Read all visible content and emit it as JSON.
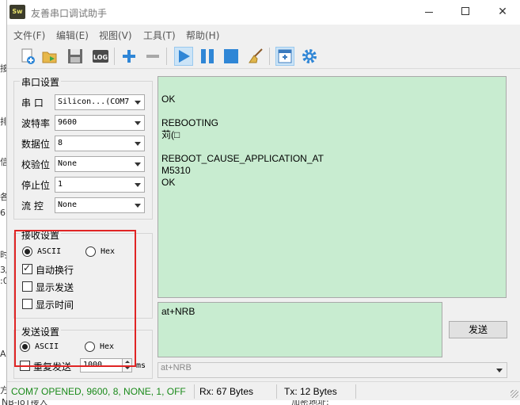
{
  "window": {
    "title": "友善串口调试助手",
    "app_icon_text": "Sw"
  },
  "menu": [
    "文件(F)",
    "编辑(E)",
    "视图(V)",
    "工具(T)",
    "帮助(H)"
  ],
  "toolbar": {
    "icons": [
      "new-icon",
      "open-icon",
      "save-icon",
      "log-icon",
      "add-icon",
      "remove-icon",
      "play-icon",
      "pause-icon",
      "stop-icon",
      "clear-broom-icon",
      "new-window-icon",
      "settings-gear-icon"
    ],
    "log_label": "LOG"
  },
  "serial": {
    "group_title": "串口设置",
    "port_label": "串  口",
    "port_value": "Silicon...(COM7",
    "baud_label": "波特率",
    "baud_value": "9600",
    "databits_label": "数据位",
    "databits_value": "8",
    "parity_label": "校验位",
    "parity_value": "None",
    "stopbits_label": "停止位",
    "stopbits_value": "1",
    "flow_label": "流  控",
    "flow_value": "None"
  },
  "receive": {
    "group_title": "接收设置",
    "ascii_label": "ASCII",
    "hex_label": "Hex",
    "format": "ASCII",
    "auto_newline_label": "自动换行",
    "auto_newline": true,
    "show_send_label": "显示发送",
    "show_send": false,
    "show_time_label": "显示时间",
    "show_time": false
  },
  "send": {
    "group_title": "发送设置",
    "ascii_label": "ASCII",
    "hex_label": "Hex",
    "format": "ASCII",
    "repeat_label": "重复发送",
    "repeat": false,
    "repeat_interval": "1000",
    "unit": "ms",
    "button_label": "发送",
    "input_text": "at+NRB",
    "history_value": "at+NRB"
  },
  "receive_log": [
    "",
    "OK",
    "",
    "REBOOTING",
    "苅(□",
    "",
    "REBOOT_CAUSE_APPLICATION_AT",
    "M5310",
    "OK"
  ],
  "status": {
    "connection": "COM7 OPENED, 9600, 8, NONE, 1, OFF",
    "rx": "Rx: 67 Bytes",
    "tx": "Tx: 12 Bytes"
  },
  "background_window": {
    "left_chars": [
      "接",
      "排",
      "信",
      "各",
      "6",
      "时",
      "3/",
      ":0",
      "A",
      "方"
    ],
    "bottom_left": "NB-IoT接入",
    "bottom_right": "加密地址:"
  },
  "colors": {
    "text_area_bg": "#c8ecd0",
    "status_ok": "#1a8a1a",
    "highlight_box": "#e02424",
    "toolbar_blue": "#2f86d6"
  }
}
